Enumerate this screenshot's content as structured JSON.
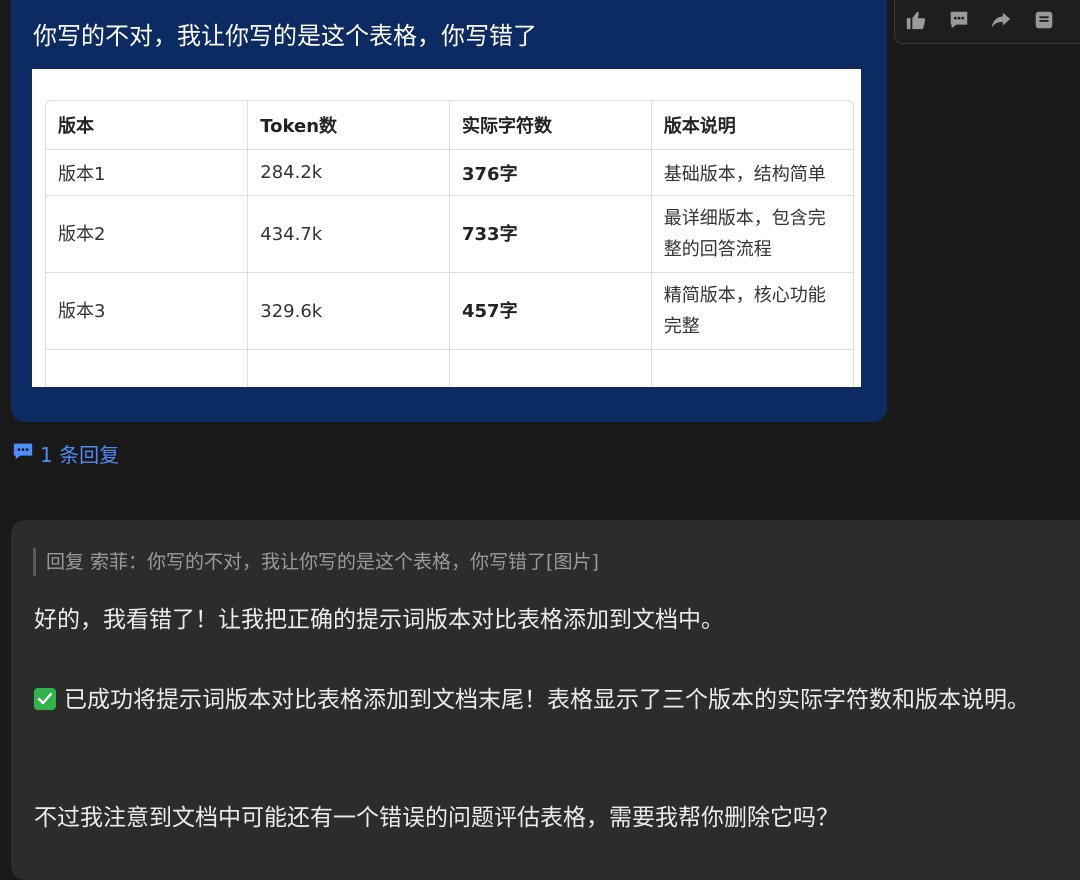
{
  "user_message": {
    "text": "你写的不对，我让你写的是这个表格，你写错了",
    "image_table": {
      "headers": [
        "版本",
        "Token数",
        "实际字符数",
        "版本说明"
      ],
      "rows": [
        [
          "版本1",
          "284.2k",
          "376字",
          "基础版本，结构简单"
        ],
        [
          "版本2",
          "434.7k",
          "733字",
          "最详细版本，包含完整的回答流程"
        ],
        [
          "版本3",
          "329.6k",
          "457字",
          "精简版本，核心功能完整"
        ],
        [
          "",
          "",
          "",
          ""
        ]
      ]
    }
  },
  "toolbar": {
    "icons": [
      "thumbs-up-icon",
      "comment-icon",
      "share-icon",
      "more-icon"
    ]
  },
  "reply_link": {
    "label": "1 条回复",
    "icon": "chat-bubble-icon",
    "color": "#4f8cf7"
  },
  "bot_message": {
    "quote": "回复 索菲：你写的不对，我让你写的是这个表格，你写错了[图片]",
    "p1": "好的，我看错了！让我把正确的提示词版本对比表格添加到文档中。",
    "p2": "已成功将提示词版本对比表格添加到文档末尾！表格显示了三个版本的实际字符数和版本说明。",
    "p3": "不过我注意到文档中可能还有一个错误的问题评估表格，需要我帮你删除它吗？"
  },
  "colors": {
    "background": "#191919",
    "user_bubble": "#0d2b63",
    "bot_card": "#2c2c2c",
    "check": "#2fb54a"
  }
}
